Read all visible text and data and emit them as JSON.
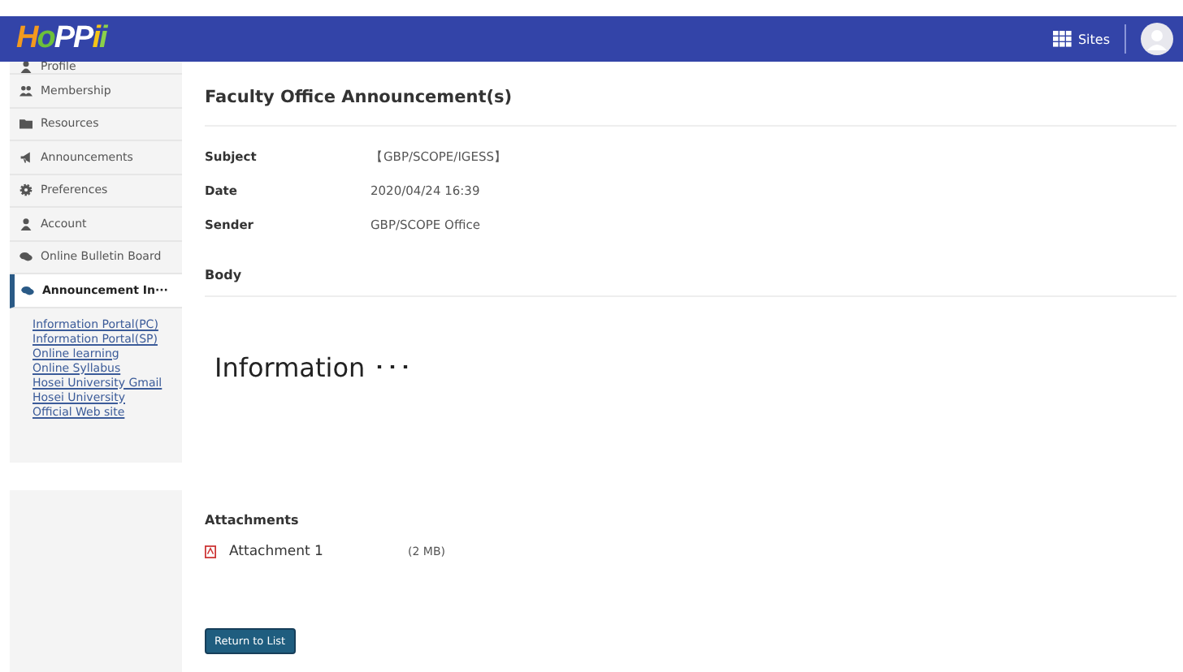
{
  "header": {
    "logo": "HoPPii",
    "sites_label": "Sites"
  },
  "sidebar": {
    "items": [
      {
        "label": "Profile",
        "kind": "person",
        "selected": false
      },
      {
        "label": "Membership",
        "kind": "group",
        "selected": false
      },
      {
        "label": "Resources",
        "kind": "folder",
        "selected": false
      },
      {
        "label": "Announcements",
        "kind": "megaphone",
        "selected": false
      },
      {
        "label": "Preferences",
        "kind": "gear",
        "selected": false
      },
      {
        "label": "Account",
        "kind": "person",
        "selected": false
      },
      {
        "label": "Online Bulletin Board",
        "kind": "chat",
        "selected": false
      },
      {
        "label": "Announcement In···",
        "kind": "chat",
        "selected": true
      }
    ],
    "links": [
      "Information Portal(PC)",
      "Information Portal(SP)",
      "Online learning",
      "Online Syllabus",
      "Hosei University Gmail",
      "Hosei University",
      "Official Web site"
    ]
  },
  "content": {
    "title": "Faculty Office Announcement(s)",
    "fields": [
      {
        "label": "Subject",
        "value": "【GBP/SCOPE/IGESS】"
      },
      {
        "label": "Date",
        "value": "2020/04/24 16:39"
      },
      {
        "label": "Sender",
        "value": "GBP/SCOPE Office"
      }
    ],
    "body_label": "Body",
    "body_text": "Information ･･･",
    "attachments_label": "Attachments",
    "attachments": [
      {
        "name": "Attachment 1",
        "size": "(2 MB)"
      }
    ],
    "button": "Return to List"
  }
}
